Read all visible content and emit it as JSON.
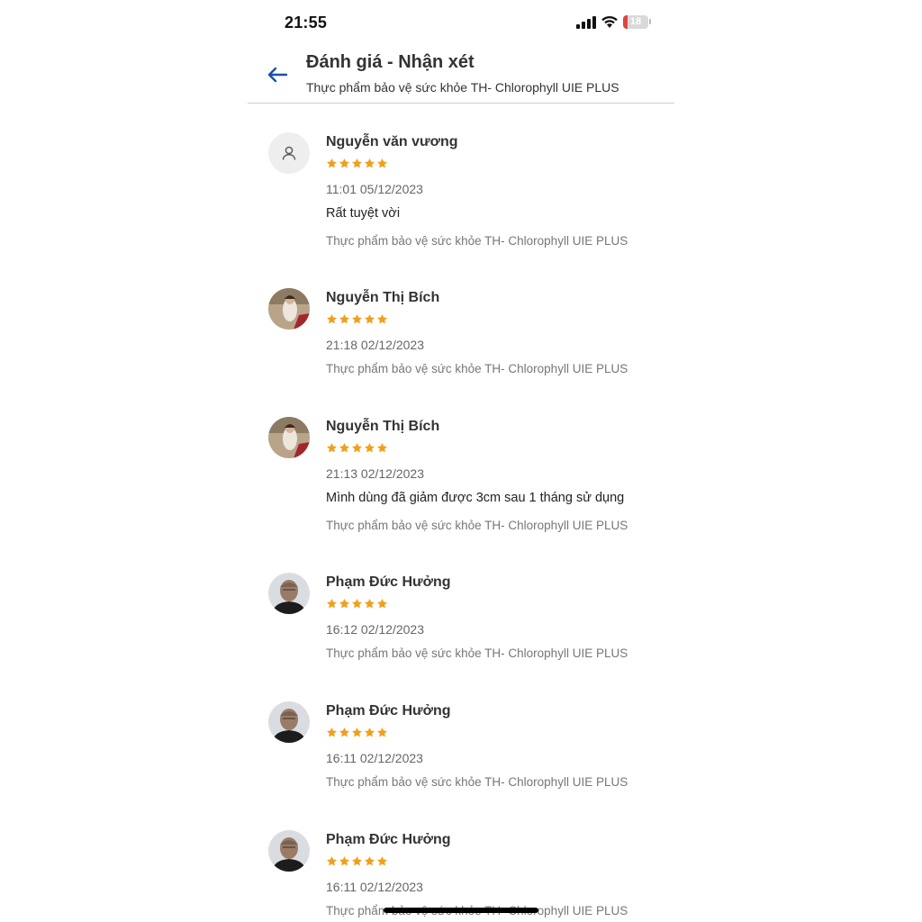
{
  "status_bar": {
    "time": "21:55",
    "battery": "18"
  },
  "header": {
    "title": "Đánh giá - Nhận xét",
    "subtitle": "Thực phẩm bảo vệ sức khỏe TH- Chlorophyll UIE PLUS",
    "back_icon": "arrow-left-icon"
  },
  "colors": {
    "star": "#f0a01c",
    "back_arrow": "#1e4fa3",
    "battery_low": "#e0443e"
  },
  "reviews": [
    {
      "name": "Nguyễn văn vương",
      "rating": 5,
      "time": "11:01 05/12/2023",
      "comment": "Rất tuyệt vời",
      "product": "Thực phẩm bảo vệ sức khỏe TH- Chlorophyll UIE PLUS",
      "avatar": "default-user-icon"
    },
    {
      "name": "Nguyễn Thị Bích",
      "rating": 5,
      "time": "21:18 02/12/2023",
      "comment": "",
      "product": "Thực phẩm bảo vệ sức khỏe TH- Chlorophyll UIE PLUS",
      "avatar": "photo-avatar"
    },
    {
      "name": "Nguyễn Thị Bích",
      "rating": 5,
      "time": "21:13 02/12/2023",
      "comment": "Mình dùng đã giảm được 3cm sau 1 tháng sử dụng",
      "product": "Thực phẩm bảo vệ sức khỏe TH- Chlorophyll UIE PLUS",
      "avatar": "photo-avatar"
    },
    {
      "name": "Phạm Đức Hưởng",
      "rating": 5,
      "time": "16:12 02/12/2023",
      "comment": "",
      "product": "Thực phẩm bảo vệ sức khỏe TH- Chlorophyll UIE PLUS",
      "avatar": "photo-avatar"
    },
    {
      "name": "Phạm Đức Hưởng",
      "rating": 5,
      "time": "16:11 02/12/2023",
      "comment": "",
      "product": "Thực phẩm bảo vệ sức khỏe TH- Chlorophyll UIE PLUS",
      "avatar": "photo-avatar"
    },
    {
      "name": "Phạm Đức Hưởng",
      "rating": 5,
      "time": "16:11 02/12/2023",
      "comment": "",
      "product": "Thực phẩm bảo vệ sức khỏe TH- Chlorophyll UIE PLUS",
      "avatar": "photo-avatar"
    }
  ]
}
